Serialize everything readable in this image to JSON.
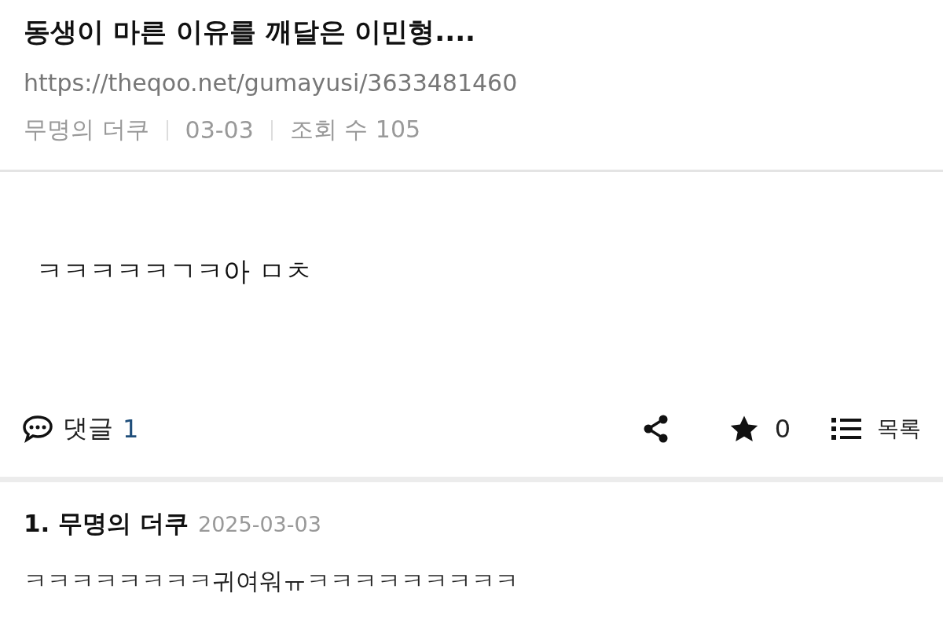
{
  "post": {
    "title": "동생이 마른 이유를 깨달은 이민형....",
    "url": "https://theqoo.net/gumayusi/3633481460",
    "meta": [
      "무명의 더쿠",
      "03-03",
      "조회 수 105"
    ],
    "body": "ㅋㅋㅋㅋㅋㄱㅋ아 ㅁㅊ"
  },
  "actions": {
    "comment_label": "댓글",
    "comment_count": "1",
    "star_count": "0",
    "list_label": "목록"
  },
  "comments": [
    {
      "number": "1.",
      "author": "무명의 더쿠",
      "date": "2025-03-03",
      "text": "ㅋㅋㅋㅋㅋㅋㅋㅋ귀여워ㅠㅋㅋㅋㅋㅋㅋㅋㅋㅋ"
    }
  ]
}
